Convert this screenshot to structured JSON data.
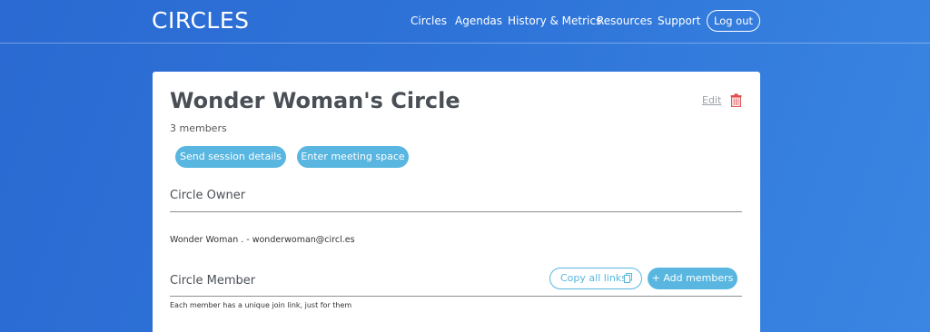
{
  "header": {
    "logo": "CIRCLES",
    "nav": [
      "Circles",
      "Agendas",
      "History & Metrics",
      "Resources",
      "Support"
    ],
    "logout": "Log out"
  },
  "circle": {
    "title": "Wonder Woman's Circle",
    "members_count": "3 members",
    "edit_label": "Edit",
    "send_session_details": "Send session details",
    "enter_meeting_space": "Enter meeting space",
    "owner_heading": "Circle Owner",
    "owner_line": "Wonder Woman . - wonderwoman@circl.es",
    "member_heading": "Circle Member",
    "copy_all_links": "Copy all links",
    "add_members": "+ Add members",
    "member_help": "Each member has a unique join link, just for them"
  },
  "colors": {
    "accent": "#58b6e0",
    "delete": "#e05050",
    "background": "#2e73d8"
  },
  "icons": [
    "trash-icon",
    "copy-icon"
  ]
}
